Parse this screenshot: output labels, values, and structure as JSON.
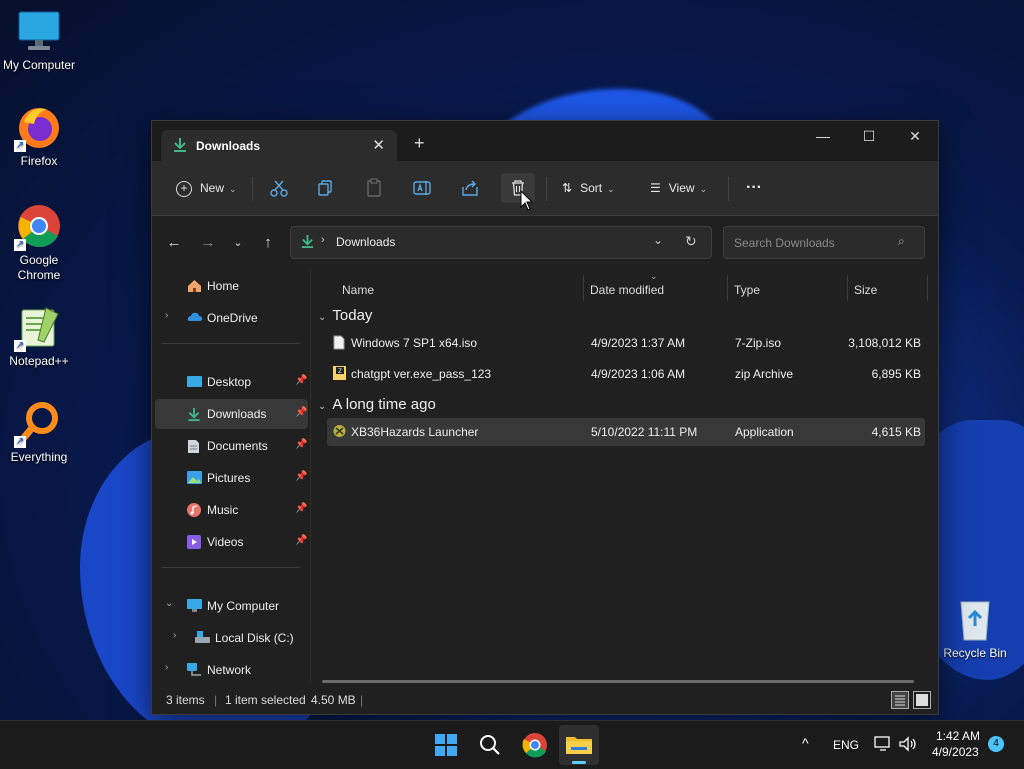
{
  "desktop": {
    "icons": [
      {
        "label": "My Computer",
        "icon": "monitor-icon"
      },
      {
        "label": "Firefox",
        "icon": "firefox-icon"
      },
      {
        "label": "Google Chrome",
        "icon": "chrome-icon"
      },
      {
        "label": "Notepad++",
        "icon": "notepadpp-icon"
      },
      {
        "label": "Everything",
        "icon": "everything-icon"
      },
      {
        "label": "Recycle Bin",
        "icon": "recycle-bin-icon"
      }
    ]
  },
  "window": {
    "tab_title": "Downloads",
    "tab_close": "✕",
    "new_tab": "+",
    "minimize": "—",
    "maximize": "☐",
    "close": "✕"
  },
  "commandbar": {
    "new_label": "New",
    "sort_label": "Sort",
    "view_label": "View",
    "more_label": "···"
  },
  "address": {
    "path": "Downloads",
    "search_placeholder": "Search Downloads"
  },
  "sidebar": {
    "items": [
      {
        "label": "Home",
        "icon": "home-icon"
      },
      {
        "label": "OneDrive",
        "icon": "onedrive-icon"
      },
      {
        "label": "Desktop",
        "icon": "desktop-folder-icon",
        "pinned": true
      },
      {
        "label": "Downloads",
        "icon": "download-icon",
        "pinned": true,
        "selected": true
      },
      {
        "label": "Documents",
        "icon": "documents-icon",
        "pinned": true
      },
      {
        "label": "Pictures",
        "icon": "pictures-icon",
        "pinned": true
      },
      {
        "label": "Music",
        "icon": "music-icon",
        "pinned": true
      },
      {
        "label": "Videos",
        "icon": "videos-icon",
        "pinned": true
      },
      {
        "label": "My Computer",
        "icon": "computer-icon"
      },
      {
        "label": "Local Disk (C:)",
        "icon": "disk-icon"
      },
      {
        "label": "Network",
        "icon": "network-icon"
      }
    ]
  },
  "file_list": {
    "columns": [
      "Name",
      "Date modified",
      "Type",
      "Size"
    ],
    "groups": [
      {
        "label": "Today",
        "files": [
          {
            "name": "Windows 7 SP1 x64.iso",
            "date": "4/9/2023 1:37 AM",
            "type": "7-Zip.iso",
            "size": "3,108,012 KB"
          },
          {
            "name": "chatgpt ver.exe_pass_123",
            "date": "4/9/2023 1:06 AM",
            "type": "zip Archive",
            "size": "6,895 KB"
          }
        ]
      },
      {
        "label": "A long time ago",
        "files": [
          {
            "name": "XB36Hazards Launcher",
            "date": "5/10/2022 11:11 PM",
            "type": "Application",
            "size": "4,615 KB",
            "selected": true
          }
        ]
      }
    ]
  },
  "status": {
    "item_count": "3 items",
    "selection": "1 item selected",
    "selection_size": "4.50 MB"
  },
  "taskbar": {
    "time": "1:42 AM",
    "date": "4/9/2023",
    "language": "ENG",
    "notification_count": "4",
    "tray_chevron": "^"
  },
  "colors": {
    "accent": "#60cdff",
    "download_green": "#3fb68b",
    "window_bg": "#202020"
  }
}
